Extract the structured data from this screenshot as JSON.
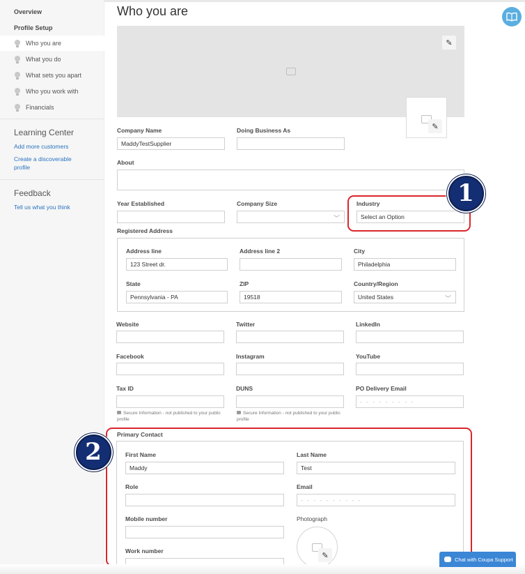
{
  "sidebar": {
    "overview": "Overview",
    "profile_setup": "Profile Setup",
    "items": [
      {
        "label": "Who you are"
      },
      {
        "label": "What you do"
      },
      {
        "label": "What sets you apart"
      },
      {
        "label": "Who you work with"
      },
      {
        "label": "Financials"
      }
    ],
    "learning_center": {
      "title": "Learning Center",
      "links": [
        "Add more customers",
        "Create a discoverable profile"
      ]
    },
    "feedback": {
      "title": "Feedback",
      "link": "Tell us what you think"
    }
  },
  "page": {
    "title": "Who you are"
  },
  "form": {
    "company_name": {
      "label": "Company Name",
      "value": "MaddyTestSupplier"
    },
    "doing_business_as": {
      "label": "Doing Business As",
      "value": ""
    },
    "about": {
      "label": "About",
      "value": ""
    },
    "year_established": {
      "label": "Year Established",
      "value": ""
    },
    "company_size": {
      "label": "Company Size",
      "value": ""
    },
    "industry": {
      "label": "Industry",
      "value": "Select an Option"
    },
    "registered_address": {
      "label": "Registered Address",
      "address_line": {
        "label": "Address line",
        "value": "123 Street dr."
      },
      "address_line_2": {
        "label": "Address line 2",
        "value": ""
      },
      "city": {
        "label": "City",
        "value": "Philadelphia"
      },
      "state": {
        "label": "State",
        "value": "Pennsylvania - PA"
      },
      "zip": {
        "label": "ZIP",
        "value": "19518"
      },
      "country": {
        "label": "Country/Region",
        "value": "United States"
      }
    },
    "website": {
      "label": "Website",
      "value": ""
    },
    "twitter": {
      "label": "Twitter",
      "value": ""
    },
    "linkedin": {
      "label": "LinkedIn",
      "value": ""
    },
    "facebook": {
      "label": "Facebook",
      "value": ""
    },
    "instagram": {
      "label": "Instagram",
      "value": ""
    },
    "youtube": {
      "label": "YouTube",
      "value": ""
    },
    "tax_id": {
      "label": "Tax ID",
      "value": ""
    },
    "duns": {
      "label": "DUNS",
      "value": ""
    },
    "po_email": {
      "label": "PO Delivery Email",
      "value": "- - - - - - - - -"
    },
    "secure_note": "Secure Information - not published to your public profile",
    "primary_contact": {
      "label": "Primary Contact",
      "first_name": {
        "label": "First Name",
        "value": "Maddy"
      },
      "last_name": {
        "label": "Last Name",
        "value": "Test"
      },
      "role": {
        "label": "Role",
        "value": ""
      },
      "email": {
        "label": "Email",
        "value": "- - - - - - - - - -"
      },
      "mobile": {
        "label": "Mobile number",
        "value": ""
      },
      "photograph": {
        "label": "Photograph"
      },
      "work": {
        "label": "Work number",
        "value": ""
      }
    }
  },
  "annotations": {
    "badge1": "1",
    "badge2": "2",
    "highlight_color": "#d9262b",
    "badge_color": "#142e73"
  },
  "chat": {
    "label": "Chat with Coupa Support"
  },
  "icons": {
    "help": "book-icon",
    "edit": "pencil-icon",
    "image": "image-placeholder-icon",
    "lock": "lock-icon",
    "chat": "chat-bubble-icon"
  }
}
